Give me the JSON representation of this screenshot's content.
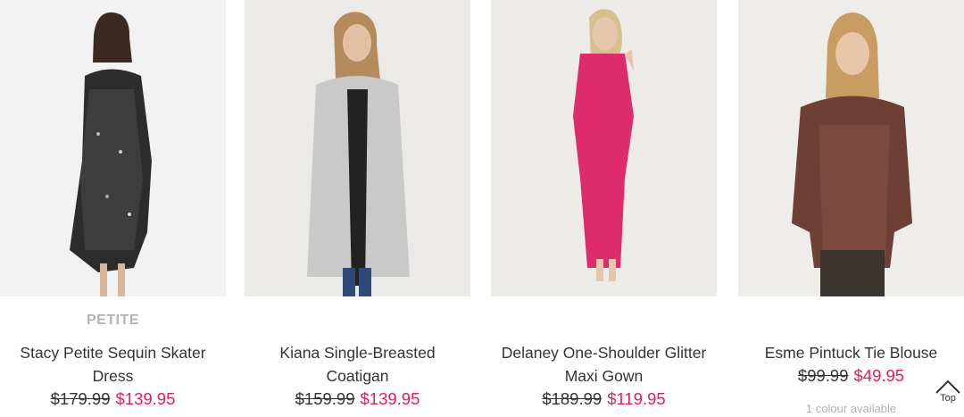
{
  "products": [
    {
      "badge": "PETITE",
      "name": "Stacy Petite Sequin Skater Dress",
      "was_price": "$179.99",
      "now_price": "$139.95",
      "colours": ""
    },
    {
      "badge": "",
      "name": "Kiana Single-Breasted Coatigan",
      "was_price": "$159.99",
      "now_price": "$139.95",
      "colours": ""
    },
    {
      "badge": "",
      "name": "Delaney One-Shoulder Glitter Maxi Gown",
      "was_price": "$189.99",
      "now_price": "$119.95",
      "colours": ""
    },
    {
      "badge": "",
      "name": "Esme Pintuck Tie Blouse",
      "was_price": "$99.99",
      "now_price": "$49.95",
      "colours": "1 colour available"
    }
  ],
  "back_to_top": {
    "label": "Top",
    "icon": "chevron-up-icon"
  },
  "colors": {
    "sale": "#e01f55",
    "badge": "#b3b3b3",
    "image_bg": "#f0efed"
  }
}
